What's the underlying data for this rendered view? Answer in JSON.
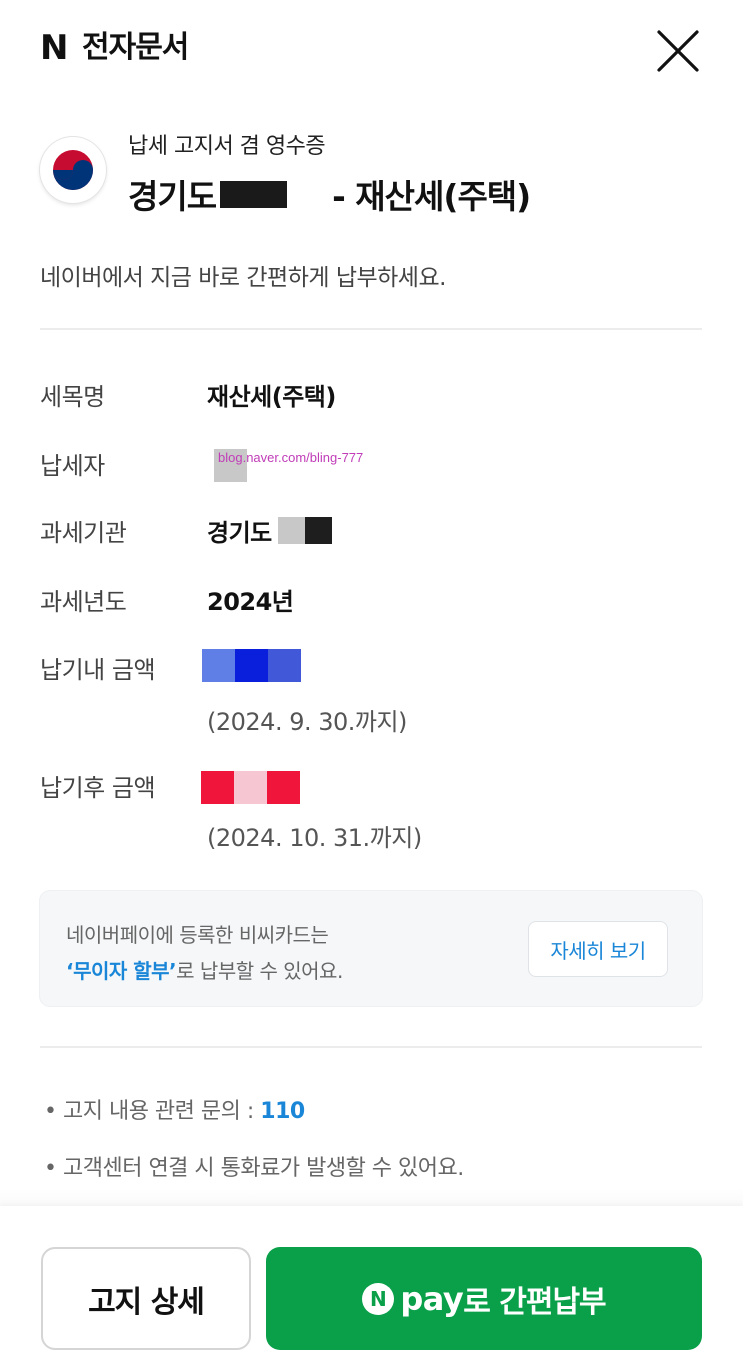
{
  "header": {
    "brand_logo": "N",
    "title": "전자문서",
    "close_icon": "close-x-icon"
  },
  "issuer": {
    "emblem_icon": "taegeuk-emblem-icon",
    "doc_type": "납세 고지서 겸 영수증",
    "title_prefix": "경기도",
    "title_suffix": "- 재산세(주택)"
  },
  "subtitle": "네이버에서 지금 바로 간편하게 납부하세요.",
  "details": {
    "tax_item": {
      "label": "세목명",
      "value": "재산세(주택)"
    },
    "taxpayer": {
      "label": "납세자",
      "watermark": "blog.naver.com/bling-777"
    },
    "tax_office": {
      "label": "과세기관",
      "value": "경기도"
    },
    "tax_year": {
      "label": "과세년도",
      "value": "2024년"
    },
    "amount_before": {
      "label": "납기내 금액",
      "due": "(2024. 9. 30.까지)"
    },
    "amount_after": {
      "label": "납기후 금액",
      "due": "(2024. 10. 31.까지)"
    }
  },
  "banner": {
    "line1": "네이버페이에 등록한 비씨카드는",
    "highlight": "‘무이자 할부’",
    "line2_rest": "로 납부할 수 있어요.",
    "button": "자세히 보기"
  },
  "notes": {
    "inquiry_label": "고지 내용 관련 문의 : ",
    "inquiry_number": "110",
    "call_fee": "고객센터 연결 시 통화료가 발생할 수 있어요."
  },
  "bottom": {
    "detail_button": "고지 상세",
    "pay_logo": "N",
    "pay_word": "pay",
    "pay_button": "로 간편납부"
  },
  "colors": {
    "accent_blue": "#1a86d7",
    "pay_green": "#0aa04a"
  }
}
